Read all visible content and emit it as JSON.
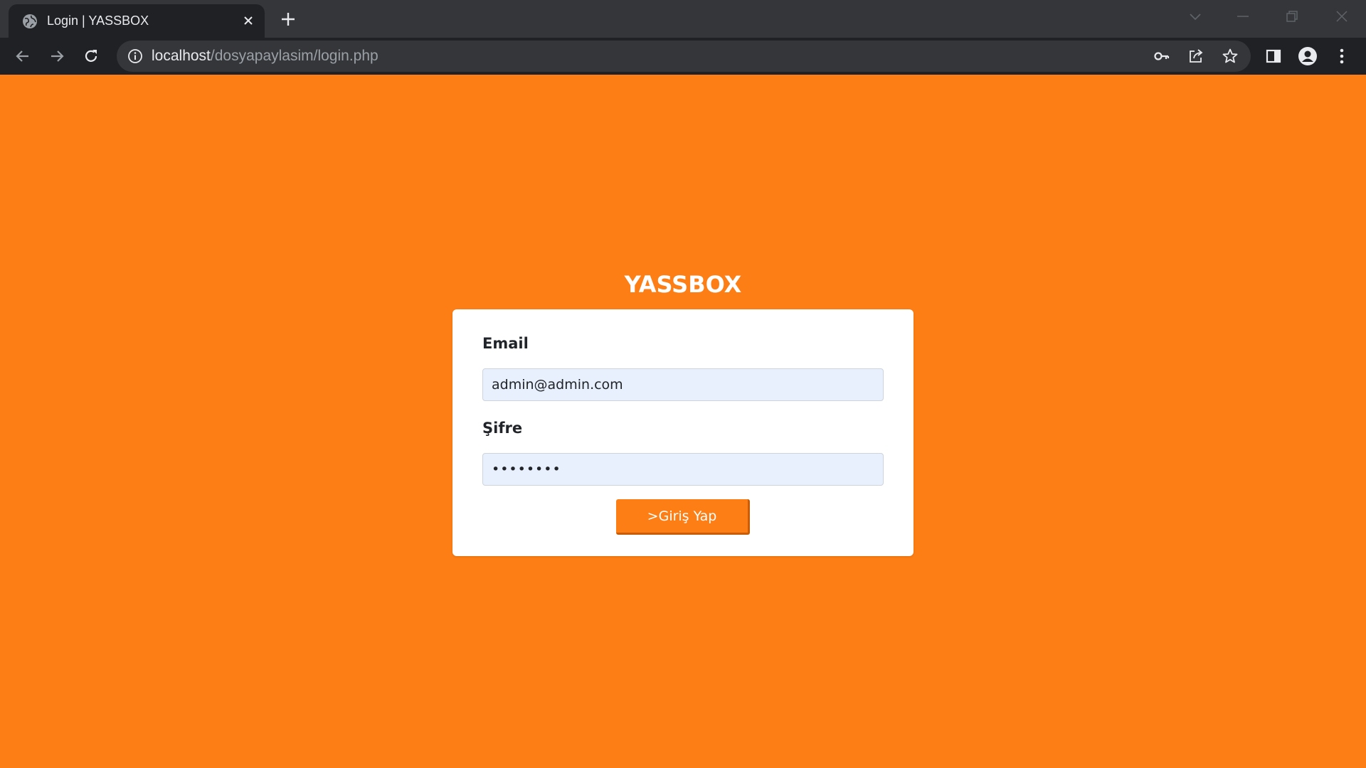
{
  "browser": {
    "tab": {
      "title": "Login | YASSBOX"
    },
    "address_bar": {
      "host": "localhost",
      "path": "/dosyapaylasim/login.php"
    },
    "icons": {
      "favicon": "globe-icon",
      "close_tab": "close-icon",
      "new_tab": "plus-icon",
      "back": "arrow-left-icon",
      "forward": "arrow-right-icon",
      "reload": "reload-icon",
      "site_info": "info-icon",
      "password": "key-icon",
      "share": "share-icon",
      "bookmark": "star-icon",
      "side_panel": "side-panel-icon",
      "profile": "profile-icon",
      "menu": "kebab-menu-icon"
    },
    "colors": {
      "frame": "#35363a",
      "toolbar": "#202124"
    }
  },
  "page": {
    "brand": "YASSBOX",
    "background_color": "#fd7e14",
    "form": {
      "email_label": "Email",
      "email_value": "admin@admin.com",
      "password_label": "Şifre",
      "password_value": "••••••••",
      "submit_label": ">Giriş Yap"
    }
  }
}
